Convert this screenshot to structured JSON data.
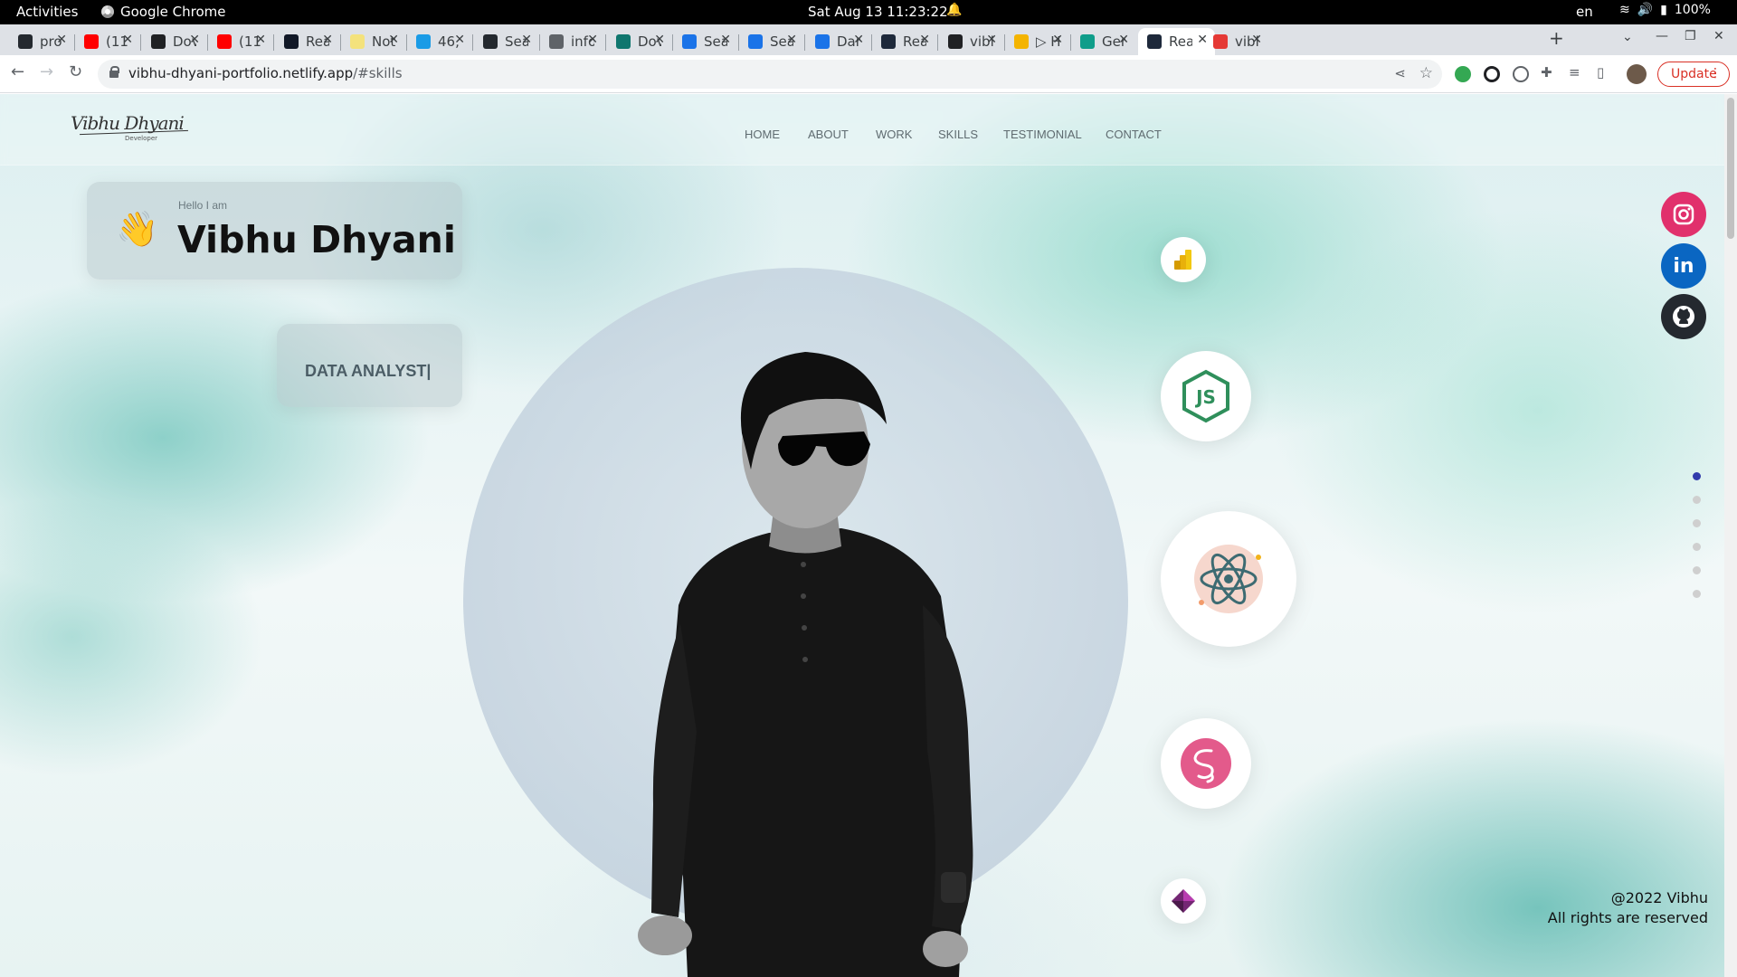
{
  "system_bar": {
    "activities": "Activities",
    "app_name": "Google Chrome",
    "clock": "Sat Aug 13  11:23:22",
    "language": "en",
    "battery": "100%"
  },
  "browser": {
    "tabs": [
      {
        "label": "pro",
        "icon": "github-icon",
        "color": "#24292f"
      },
      {
        "label": "(11",
        "icon": "youtube-icon",
        "color": "#ff0000"
      },
      {
        "label": "Dov",
        "icon": "site-icon",
        "color": "#202124"
      },
      {
        "label": "(11",
        "icon": "youtube-icon",
        "color": "#ff0000"
      },
      {
        "label": "Rea",
        "icon": "site-icon",
        "color": "#111827"
      },
      {
        "label": "Not",
        "icon": "notes-icon",
        "color": "#f4e27c"
      },
      {
        "label": "46,",
        "icon": "site-icon",
        "color": "#1a9be6"
      },
      {
        "label": "Sea",
        "icon": "site-icon",
        "color": "#24292f"
      },
      {
        "label": "info",
        "icon": "globe-icon",
        "color": "#5f6368"
      },
      {
        "label": "Dov",
        "icon": "site-icon",
        "color": "#0f766e"
      },
      {
        "label": "Sea",
        "icon": "site-icon",
        "color": "#1a73e8"
      },
      {
        "label": "Sea",
        "icon": "site-icon",
        "color": "#1a73e8"
      },
      {
        "label": "Dar",
        "icon": "site-icon",
        "color": "#1a73e8"
      },
      {
        "label": "Rea",
        "icon": "site-icon",
        "color": "#1e293b"
      },
      {
        "label": "vibl",
        "icon": "site-icon",
        "color": "#202124"
      },
      {
        "label": "▷ H",
        "icon": "site-icon",
        "color": "#f4b400"
      },
      {
        "label": "Ger",
        "icon": "site-icon",
        "color": "#0f9d8a"
      },
      {
        "label": "Rea",
        "icon": "site-icon",
        "color": "#1e293b",
        "active": true
      },
      {
        "label": "vibl",
        "icon": "site-icon",
        "color": "#e53935"
      }
    ],
    "url_host": "vibhu-dhyani-portfolio.netlify.app",
    "url_path": "/#skills",
    "update_label": "Update"
  },
  "site": {
    "logo_text": "Vibhu Dhyani",
    "logo_tagline": "Developer",
    "nav": [
      "HOME",
      "ABOUT",
      "WORK",
      "SKILLS",
      "TESTIMONIAL",
      "CONTACT"
    ],
    "greeting": "Hello I am",
    "name": "Vibhu Dhyani",
    "role": "DATA ANALYST|",
    "skills": [
      "power-bi-icon",
      "nodejs-icon",
      "react-icon",
      "sass-icon",
      "power-apps-icon"
    ],
    "social": [
      {
        "name": "instagram-icon",
        "color": "#e1306c"
      },
      {
        "name": "linkedin-icon",
        "color": "#0a66c2"
      },
      {
        "name": "github-icon",
        "color": "#24292f"
      }
    ],
    "page_dots": 6,
    "active_dot": 0,
    "copyright_line1": "@2022 Vibhu",
    "copyright_line2": "All rights are reserved"
  },
  "colors": {
    "accent": "#313bac",
    "update_red": "#d93025"
  }
}
